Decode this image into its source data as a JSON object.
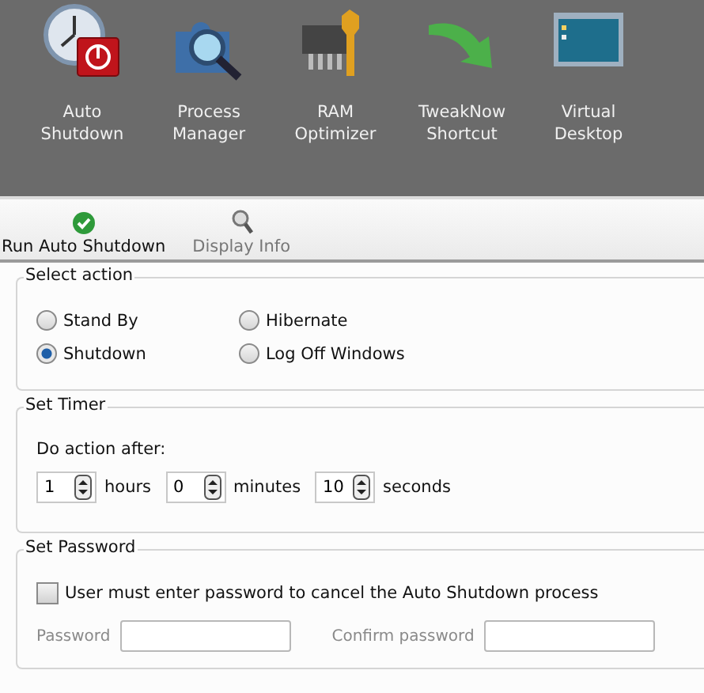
{
  "modules": [
    {
      "kind": "clock",
      "label": "Auto\nShutdown"
    },
    {
      "kind": "puzzle",
      "label": "Process\nManager"
    },
    {
      "kind": "chip",
      "label": "RAM\nOptimizer"
    },
    {
      "kind": "arrow",
      "label": "TweakNow\nShortcut"
    },
    {
      "kind": "desktop",
      "label": "Virtual\nDesktop"
    }
  ],
  "toolbar": [
    {
      "kind": "check",
      "label": "Run Auto Shutdown",
      "disabled": false
    },
    {
      "kind": "magnifier",
      "label": "Display Info",
      "disabled": true
    }
  ],
  "select_action": {
    "title": "Select action",
    "options": [
      {
        "label": "Stand By",
        "selected": false
      },
      {
        "label": "Hibernate",
        "selected": false
      },
      {
        "label": "Shutdown",
        "selected": true
      },
      {
        "label": "Log Off Windows",
        "selected": false
      }
    ]
  },
  "set_timer": {
    "title": "Set Timer",
    "prompt": "Do action after:",
    "fields": [
      {
        "value": "1",
        "unit": "hours"
      },
      {
        "value": "0",
        "unit": "minutes"
      },
      {
        "value": "10",
        "unit": "seconds"
      }
    ]
  },
  "set_password": {
    "title": "Set Password",
    "checkbox": {
      "label": "User must enter password to cancel the Auto Shutdown process",
      "checked": false
    },
    "fields": [
      {
        "label": "Password",
        "disabled": true
      },
      {
        "label": "Confirm password",
        "disabled": true
      }
    ]
  }
}
